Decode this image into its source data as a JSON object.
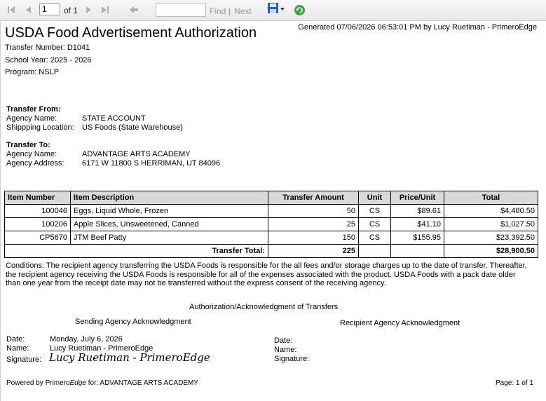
{
  "toolbar": {
    "page_value": "1",
    "of_label": "of 1",
    "find_placeholder": "",
    "find_label": "Find",
    "separator": "|",
    "next_label": "Next"
  },
  "header": {
    "title": "USDA Food Advertisement Authorization",
    "generated": "Generated 07/06/2026 06:53:01 PM by Lucy Ruetiman - PrimeroEdge",
    "transfer_number": "Transfer Number: D1041",
    "school_year": "School Year: 2025 - 2026",
    "program": "Program: NSLP"
  },
  "transfer_from": {
    "heading": "Transfer From:",
    "agency_label": "Agency Name:",
    "agency_value": "STATE ACCOUNT",
    "location_label": "Shippping Location:",
    "location_value": "US Foods (State Warehouse)"
  },
  "transfer_to": {
    "heading": "Transfer To:",
    "agency_label": "Agency Name:",
    "agency_value": "ADVANTAGE ARTS ACADEMY",
    "address_label": "Agency Address:",
    "address_value": "6171 W 11800 S  HERRIMAN, UT 84096"
  },
  "table": {
    "headers": [
      "Item Number",
      "Item Description",
      "Transfer Amount",
      "Unit",
      "Price/Unit",
      "Total"
    ],
    "rows": [
      {
        "item_number": "100046",
        "description": "Eggs, Liquid Whole, Frozen",
        "amount": "50",
        "unit": "CS",
        "price": "$89.61",
        "total": "$4,480.50"
      },
      {
        "item_number": "100206",
        "description": "Apple Slices, Unsweetened, Canned",
        "amount": "25",
        "unit": "CS",
        "price": "$41.10",
        "total": "$1,027.50"
      },
      {
        "item_number": "CP5670",
        "description": "JTM Beef Patty",
        "amount": "150",
        "unit": "CS",
        "price": "$155.95",
        "total": "$23,392.50"
      }
    ],
    "total_label": "Transfer Total:",
    "total_amount": "225",
    "total_value": "$28,900.50"
  },
  "conditions": "Conditions: The recipient agency transferring the USDA Foods is responsible for the all fees and/or storage charges up to the date of transfer. Thereafter, the recipient agency receiving the USDA Foods is responsible for all of the expenses associated with the product. USDA Foods with a pack date older than one year from the receipt date may not be transferred without the express consent of the receiving agency.",
  "ack": {
    "heading": "Authorization/Acknowledgment of Transfers",
    "sending_heading": "Sending Agency Acknowledgment",
    "recipient_heading": "Recipient Agency Acknowledgment",
    "date_label": "Date:",
    "name_label": "Name:",
    "signature_label": "Signature:",
    "sending_date": "Monday, July 6, 2026",
    "sending_name": "Lucy Ruetiman - PrimeroEdge",
    "sending_signature": "Lucy Ruetiman - PrimeroEdge"
  },
  "footer": {
    "powered_by_prefix": "Powered by Primero",
    "powered_by_edge": "Edge",
    "powered_by_suffix": " for: ADVANTAGE ARTS ACADEMY",
    "page": "Page: 1 of 1"
  },
  "icons": {
    "first": "first-page-icon",
    "prev": "previous-page-icon",
    "next": "next-page-icon",
    "last": "last-page-icon",
    "back": "back-icon",
    "export": "save-export-icon",
    "refresh": "refresh-icon"
  }
}
